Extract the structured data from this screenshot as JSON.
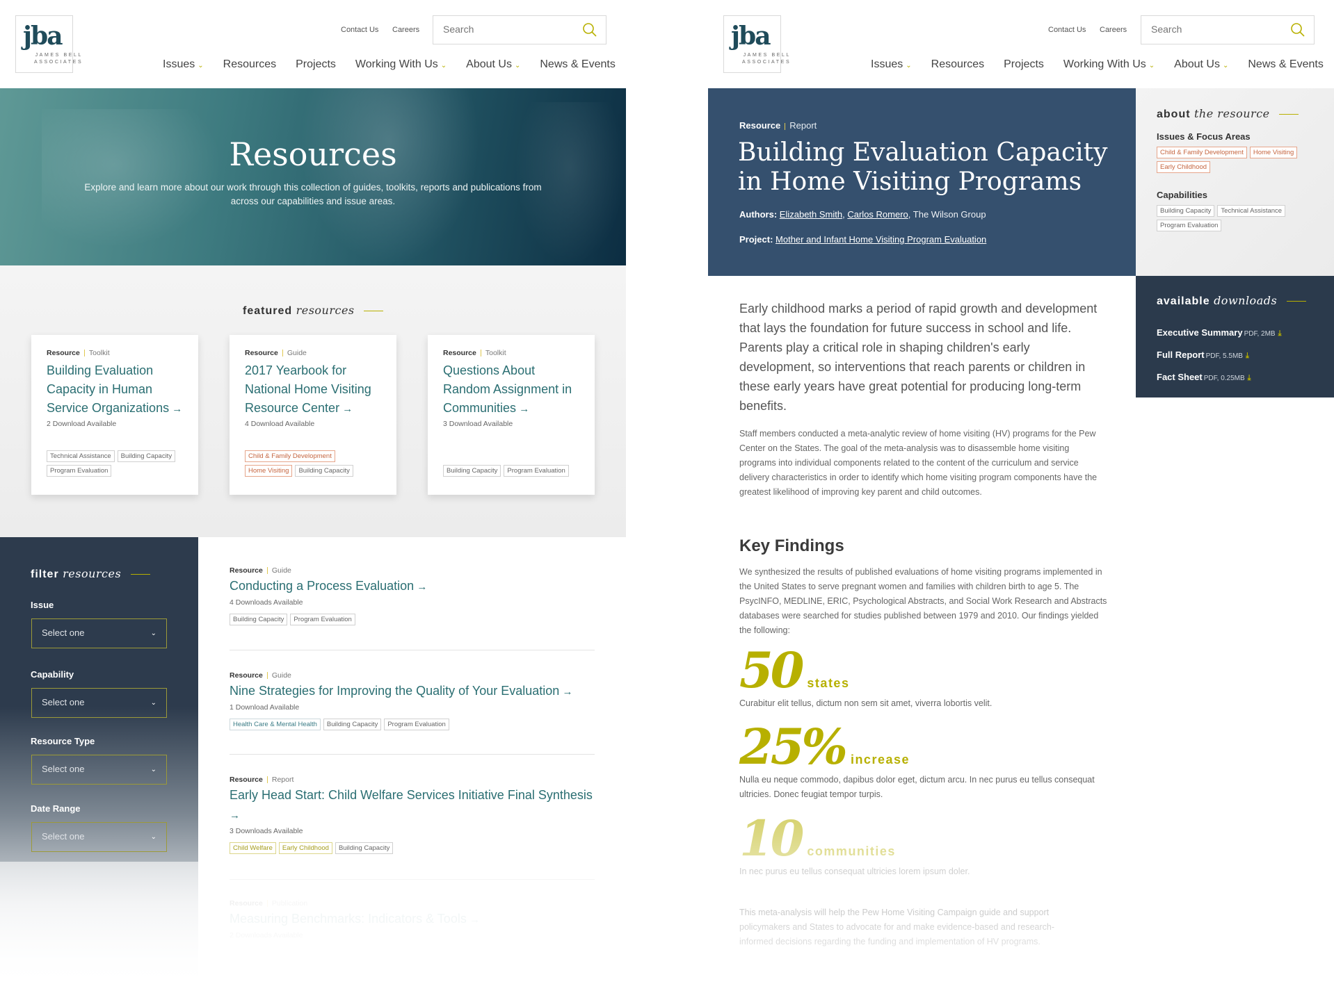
{
  "colors": {
    "teal_link": "#2a6e72",
    "olive_accent": "#b7b000",
    "navy_panel": "#35506e",
    "dark_panel": "#2b3a4c",
    "tag_orange": "#c5653f"
  },
  "header": {
    "logo": {
      "mark": "jba",
      "line1": "JAMES BELL",
      "line2": "ASSOCIATES"
    },
    "utility_links": [
      "Contact Us",
      "Careers"
    ],
    "search": {
      "placeholder": "Search",
      "icon": "search-icon"
    },
    "nav": [
      {
        "label": "Issues",
        "has_dropdown": true
      },
      {
        "label": "Resources",
        "has_dropdown": false
      },
      {
        "label": "Projects",
        "has_dropdown": false
      },
      {
        "label": "Working With Us",
        "has_dropdown": true
      },
      {
        "label": "About Us",
        "has_dropdown": true
      },
      {
        "label": "News & Events",
        "has_dropdown": false
      }
    ]
  },
  "resources_page": {
    "hero": {
      "title": "Resources",
      "subtitle": "Explore and learn more about our work through this collection of guides, toolkits, reports and publications from across our capabilities and issue areas."
    },
    "featured": {
      "title_bold": "featured",
      "title_italic": "resources",
      "cards": [
        {
          "category": "Resource",
          "type": "Toolkit",
          "title": "Building Evaluation Capacity in Human Service Organizations",
          "downloads": "2 Download Available",
          "tags": [
            {
              "label": "Technical Assistance",
              "style": "gray"
            },
            {
              "label": "Building Capacity",
              "style": "gray"
            },
            {
              "label": "Program Evaluation",
              "style": "gray"
            }
          ]
        },
        {
          "category": "Resource",
          "type": "Guide",
          "title": "2017 Yearbook for National Home Visiting Resource Center",
          "downloads": "4 Download Available",
          "tags": [
            {
              "label": "Child & Family Development",
              "style": "orange"
            },
            {
              "label": "Home Visiting",
              "style": "orange"
            },
            {
              "label": "Building Capacity",
              "style": "gray"
            }
          ]
        },
        {
          "category": "Resource",
          "type": "Toolkit",
          "title": "Questions About Random Assignment in Communities",
          "downloads": "3 Download Available",
          "tags": [
            {
              "label": "Building Capacity",
              "style": "gray"
            },
            {
              "label": "Program Evaluation",
              "style": "gray"
            }
          ]
        }
      ]
    },
    "filter": {
      "title_bold": "filter",
      "title_italic": "resources",
      "fields": [
        {
          "label": "Issue",
          "value": "Select one"
        },
        {
          "label": "Capability",
          "value": "Select one"
        },
        {
          "label": "Resource Type",
          "value": "Select one"
        },
        {
          "label": "Date Range",
          "value": "Select one"
        }
      ]
    },
    "list": [
      {
        "category": "Resource",
        "type": "Guide",
        "title": "Conducting a Process Evaluation",
        "downloads": "4 Downloads Available",
        "tags": [
          {
            "label": "Building Capacity",
            "style": "gray"
          },
          {
            "label": "Program Evaluation",
            "style": "gray"
          }
        ]
      },
      {
        "category": "Resource",
        "type": "Guide",
        "title": "Nine Strategies for Improving the Quality of Your Evaluation",
        "downloads": "1 Download Available",
        "tags": [
          {
            "label": "Health Care & Mental Health",
            "style": "blue"
          },
          {
            "label": "Building Capacity",
            "style": "gray"
          },
          {
            "label": "Program Evaluation",
            "style": "gray"
          }
        ]
      },
      {
        "category": "Resource",
        "type": "Report",
        "title": "Early Head Start: Child Welfare Services Initiative Final Synthesis",
        "downloads": "3 Downloads Available",
        "tags": [
          {
            "label": "Child Welfare",
            "style": "olive"
          },
          {
            "label": "Early Childhood",
            "style": "olive"
          },
          {
            "label": "Building Capacity",
            "style": "gray"
          }
        ]
      },
      {
        "category": "Resource",
        "type": "Publication",
        "title": "Measuring Benchmarks: Indicators & Tools",
        "downloads": "2 Downloads Available",
        "tags": []
      }
    ]
  },
  "detail_page": {
    "category": "Resource",
    "type": "Report",
    "title": "Building Evaluation Capacity in Home Visiting Programs",
    "authors_label": "Authors:",
    "authors": [
      {
        "name": "Elizabeth Smith",
        "link": true
      },
      {
        "name": "Carlos Romero",
        "link": true
      },
      {
        "name": "The Wilson Group",
        "link": false
      }
    ],
    "project_label": "Project:",
    "project": "Mother and Infant Home Visiting Program Evaluation",
    "about": {
      "title_bold": "about",
      "title_italic": "the resource",
      "issues_heading": "Issues & Focus Areas",
      "issues": [
        "Child & Family Development",
        "Home Visiting",
        "Early Childhood"
      ],
      "capabilities_heading": "Capabilities",
      "capabilities": [
        "Building Capacity",
        "Technical Assistance",
        "Program Evaluation"
      ]
    },
    "downloads": {
      "title_bold": "available",
      "title_italic": "downloads",
      "items": [
        {
          "name": "Executive Summary",
          "size": "PDF, 2MB"
        },
        {
          "name": "Full Report",
          "size": "PDF, 5.5MB"
        },
        {
          "name": "Fact Sheet",
          "size": "PDF, 0.25MB"
        }
      ]
    },
    "lede": "Early childhood marks a period of rapid growth and development that lays the foundation for future success in school and life. Parents play a critical role in shaping children's early development, so interventions that reach parents or children in these early years have great potential for producing long-term benefits.",
    "body": "Staff members conducted a meta-analytic review of home visiting (HV) programs for the Pew Center on the States. The goal of the meta-analysis was to disassemble home visiting programs into individual components related to the content of the curriculum and service delivery characteristics in order to identify which home visiting program components have the greatest likelihood of improving key parent and child outcomes.",
    "key_findings": {
      "title": "Key Findings",
      "intro": "We synthesized the results of published evaluations of home visiting programs implemented in the United States to serve pregnant women and families with children birth to age 5. The PsycINFO, MEDLINE, ERIC, Psychological Abstracts, and Social Work Research and Abstracts databases were searched for studies published between 1979 and 2010. Our findings yielded the following:",
      "stats": [
        {
          "value": "50",
          "unit": "states",
          "desc": "Curabitur elit tellus, dictum non sem sit amet, viverra lobortis velit."
        },
        {
          "value": "25%",
          "unit": "increase",
          "desc": "Nulla eu neque commodo, dapibus dolor eget, dictum arcu. In nec purus eu tellus consequat ultricies. Donec feugiat tempor turpis."
        },
        {
          "value": "10",
          "unit": "communities",
          "desc": "In nec purus eu tellus consequat ultricies lorem ipsum doler."
        }
      ],
      "closing": "This meta-analysis will help the Pew Home Visiting Campaign guide and support policymakers and States to advocate for and make evidence-based and research-informed decisions regarding the funding and implementation of HV programs."
    }
  }
}
